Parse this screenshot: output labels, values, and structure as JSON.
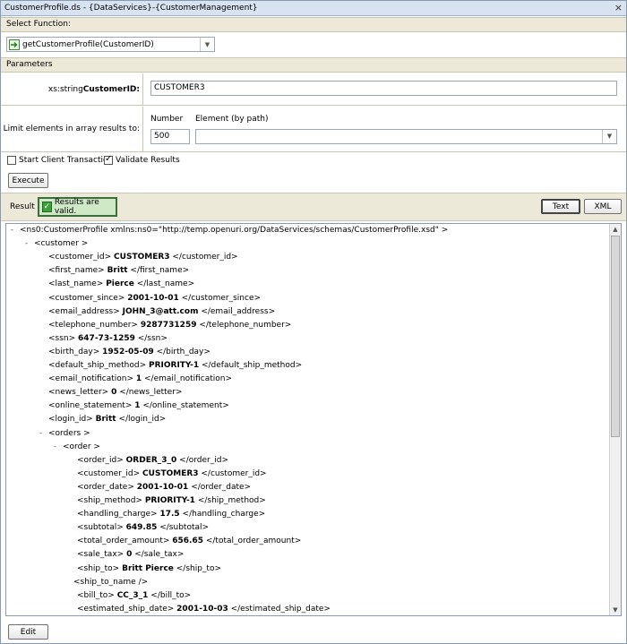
{
  "window": {
    "title": "CustomerProfile.ds - {DataServices}-{CustomerManagement}",
    "close_glyph": "×"
  },
  "select_function": {
    "header": "Select Function:",
    "selected": "getCustomerProfile(CustomerID)"
  },
  "parameters": {
    "header": "Parameters",
    "customer_id": {
      "label_type": "xs:string ",
      "label_name": "CustomerID:",
      "value": "CUSTOMER3"
    },
    "limit": {
      "label": "Limit elements in array results to:",
      "number_label": "Number",
      "element_label": "Element (by path)",
      "number_value": "500",
      "element_value": ""
    }
  },
  "options": {
    "start_transaction": {
      "label": "Start Client Transaction",
      "checked": false
    },
    "validate_results": {
      "label": "Validate Results",
      "checked": true
    }
  },
  "execute_label": "Execute",
  "result": {
    "label": "Result",
    "status": "Results are valid.",
    "text_button": "Text",
    "xml_button": "XML"
  },
  "tree": [
    {
      "pre": "<ns0:CustomerProfile xmlns:ns0=\"http://temp.openuri.org/DataServices/schemas/CustomerProfile.xsd\" >",
      "bold": "",
      "post": "",
      "level": 0,
      "toggle": "-"
    },
    {
      "pre": "<customer >",
      "bold": "",
      "post": "",
      "level": 1,
      "toggle": "-"
    },
    {
      "pre": "<customer_id> ",
      "bold": "CUSTOMER3",
      "post": " </customer_id>",
      "level": 2,
      "toggle": ""
    },
    {
      "pre": "<first_name> ",
      "bold": "Britt",
      "post": " </first_name>",
      "level": 2,
      "toggle": ""
    },
    {
      "pre": "<last_name> ",
      "bold": "Pierce",
      "post": " </last_name>",
      "level": 2,
      "toggle": ""
    },
    {
      "pre": "<customer_since> ",
      "bold": "2001-10-01",
      "post": " </customer_since>",
      "level": 2,
      "toggle": ""
    },
    {
      "pre": "<email_address> ",
      "bold": "JOHN_3@att.com",
      "post": " </email_address>",
      "level": 2,
      "toggle": ""
    },
    {
      "pre": "<telephone_number> ",
      "bold": "9287731259",
      "post": " </telephone_number>",
      "level": 2,
      "toggle": ""
    },
    {
      "pre": "<ssn> ",
      "bold": "647-73-1259",
      "post": " </ssn>",
      "level": 2,
      "toggle": ""
    },
    {
      "pre": "<birth_day> ",
      "bold": "1952-05-09",
      "post": " </birth_day>",
      "level": 2,
      "toggle": ""
    },
    {
      "pre": "<default_ship_method> ",
      "bold": "PRIORITY-1",
      "post": " </default_ship_method>",
      "level": 2,
      "toggle": ""
    },
    {
      "pre": "<email_notification> ",
      "bold": "1",
      "post": " </email_notification>",
      "level": 2,
      "toggle": ""
    },
    {
      "pre": "<news_letter> ",
      "bold": "0",
      "post": " </news_letter>",
      "level": 2,
      "toggle": ""
    },
    {
      "pre": "<online_statement> ",
      "bold": "1",
      "post": " </online_statement>",
      "level": 2,
      "toggle": ""
    },
    {
      "pre": "<login_id> ",
      "bold": "Britt",
      "post": " </login_id>",
      "level": 2,
      "toggle": ""
    },
    {
      "pre": "<orders >",
      "bold": "",
      "post": "",
      "level": 2,
      "toggle": "-"
    },
    {
      "pre": "<order >",
      "bold": "",
      "post": "",
      "level": 3,
      "toggle": "-"
    },
    {
      "pre": "<order_id> ",
      "bold": "ORDER_3_0",
      "post": " </order_id>",
      "level": 4,
      "toggle": ""
    },
    {
      "pre": "<customer_id> ",
      "bold": "CUSTOMER3",
      "post": " </customer_id>",
      "level": 4,
      "toggle": ""
    },
    {
      "pre": "<order_date> ",
      "bold": "2001-10-01",
      "post": " </order_date>",
      "level": 4,
      "toggle": ""
    },
    {
      "pre": "<ship_method> ",
      "bold": "PRIORITY-1",
      "post": " </ship_method>",
      "level": 4,
      "toggle": ""
    },
    {
      "pre": "<handling_charge> ",
      "bold": "17.5",
      "post": " </handling_charge>",
      "level": 4,
      "toggle": ""
    },
    {
      "pre": "<subtotal> ",
      "bold": "649.85",
      "post": " </subtotal>",
      "level": 4,
      "toggle": ""
    },
    {
      "pre": "<total_order_amount> ",
      "bold": "656.65",
      "post": " </total_order_amount>",
      "level": 4,
      "toggle": ""
    },
    {
      "pre": "<sale_tax> ",
      "bold": "0",
      "post": " </sale_tax>",
      "level": 4,
      "toggle": ""
    },
    {
      "pre": "<ship_to> ",
      "bold": "Britt Pierce",
      "post": " </ship_to>",
      "level": 4,
      "toggle": ""
    },
    {
      "pre": "<ship_to_name />",
      "bold": "",
      "post": "",
      "level": 3.75,
      "toggle": ""
    },
    {
      "pre": "<bill_to> ",
      "bold": "CC_3_1",
      "post": " </bill_to>",
      "level": 4,
      "toggle": ""
    },
    {
      "pre": "<estimated_ship_date> ",
      "bold": "2001-10-03",
      "post": " </estimated_ship_date>",
      "level": 4,
      "toggle": ""
    }
  ],
  "edit_label": "Edit"
}
